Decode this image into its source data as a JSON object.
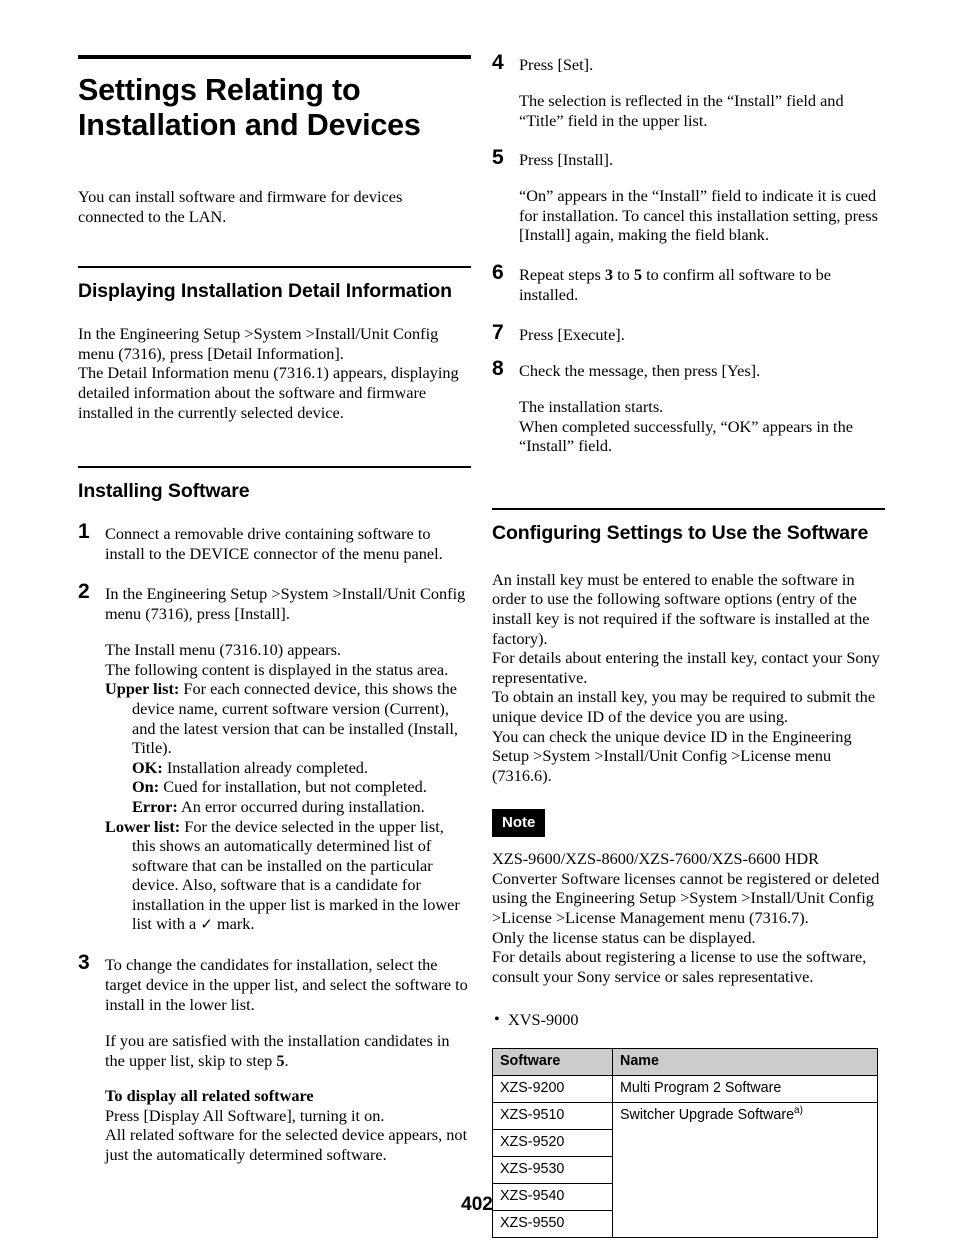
{
  "page": {
    "number": "402"
  },
  "left_column": {
    "doc_title": "Settings Relating to Installation and Devices",
    "intro": "You can install software and firmware for devices connected to the LAN.",
    "section_detail": {
      "heading": "Displaying Installation Detail Information",
      "para1": "In the Engineering Setup >System >Install/Unit Config menu (7316), press [Detail Information].",
      "para2": "The Detail Information menu (7316.1) appears, displaying detailed information about the software and firmware installed in the currently selected device."
    },
    "section_installing": {
      "heading": "Installing Software",
      "steps": [
        {
          "num": "1",
          "text": "Connect a removable drive containing software to install to the DEVICE connector of the menu panel."
        },
        {
          "num": "2",
          "text": "In the Engineering Setup >System >Install/Unit Config menu (7316), press [Install]."
        },
        {
          "num": "3",
          "text": "To change the candidates for installation, select the target device in the upper list, and select the software to install in the lower list."
        }
      ],
      "step2_details": {
        "line1": "The Install menu (7316.10) appears.",
        "line2": "The following content is displayed in the status area.",
        "upper_list_label": "Upper list:",
        "upper_list_text": "For each connected device, this shows the device name, current software version (Current), and the latest version that can be installed (Install, Title).",
        "status_ok_label": "OK:",
        "status_ok_text": "Installation already completed.",
        "status_on_label": "On:",
        "status_on_text": "Cued for installation, but not completed.",
        "status_error_label": "Error:",
        "status_error_text": "An error occurred during installation.",
        "lower_list_label": "Lower list:",
        "lower_list_text_a": "For the device selected in the upper list, this shows an automatically determined list of software that can be installed on the particular device. Also, software that is a candidate for installation in the upper list is marked in the lower list with a",
        "lower_list_check": "✓",
        "lower_list_text_b": "mark."
      },
      "step3_details": {
        "skip_text_a": "If you are satisfied with the installation candidates in the upper list, skip to step",
        "skip_step": "5",
        "skip_text_b": ".",
        "subhead": "To display all related software",
        "line1": "Press [Display All Software], turning it on.",
        "line2": "All related software for the selected device appears, not just the automatically determined software."
      }
    }
  },
  "right_column": {
    "steps": [
      {
        "num": "4",
        "text": "Press [Set].",
        "detail": "The selection is reflected in the “Install” field and “Title” field in the upper list."
      },
      {
        "num": "5",
        "text": "Press [Install].",
        "detail": "“On” appears in the “Install” field to indicate it is cued for installation. To cancel this installation setting, press [Install] again, making the field blank."
      },
      {
        "num": "6",
        "text_a": "Repeat steps",
        "ref1": "3",
        "text_b": "to",
        "ref2": "5",
        "text_c": "to confirm all software to be installed."
      },
      {
        "num": "7",
        "text": "Press [Execute]."
      },
      {
        "num": "8",
        "text": "Check the message, then press [Yes].",
        "detail_line1": "The installation starts.",
        "detail_line2": "When completed successfully, “OK” appears in the “Install” field."
      }
    ],
    "section_configuring": {
      "heading": "Configuring Settings to Use the Software",
      "para1": "An install key must be entered to enable the software in order to use the following software options (entry of the install key is not required if the software is installed at the factory).",
      "para2": "For details about entering the install key, contact your Sony representative.",
      "para3": "To obtain an install key, you may be required to submit the unique device ID of the device you are using.",
      "para4": "You can check the unique device ID in the Engineering Setup >System >Install/Unit Config >License menu (7316.6).",
      "note_badge": "Note",
      "note_para1": "XZS-9600/XZS-8600/XZS-7600/XZS-6600 HDR Converter Software licenses cannot be registered or deleted using the Engineering Setup >System >Install/Unit Config >License >License Management menu (7316.7).",
      "note_para2": "Only the license status can be displayed.",
      "note_para3": "For details about registering a license to use the software, consult your Sony service or sales representative.",
      "bullet_item": "XVS-9000",
      "bullet_dot": "•",
      "table": {
        "headers": [
          "Software",
          "Name"
        ],
        "rows": [
          {
            "software": "XZS-9200",
            "name": "Multi Program 2 Software",
            "footnote": ""
          },
          {
            "software": "XZS-9510",
            "name": "Switcher Upgrade Software",
            "footnote": "a)"
          },
          {
            "software": "XZS-9520",
            "name": "",
            "footnote": ""
          },
          {
            "software": "XZS-9530",
            "name": "",
            "footnote": ""
          },
          {
            "software": "XZS-9540",
            "name": "",
            "footnote": ""
          },
          {
            "software": "XZS-9550",
            "name": "",
            "footnote": ""
          }
        ]
      }
    }
  }
}
